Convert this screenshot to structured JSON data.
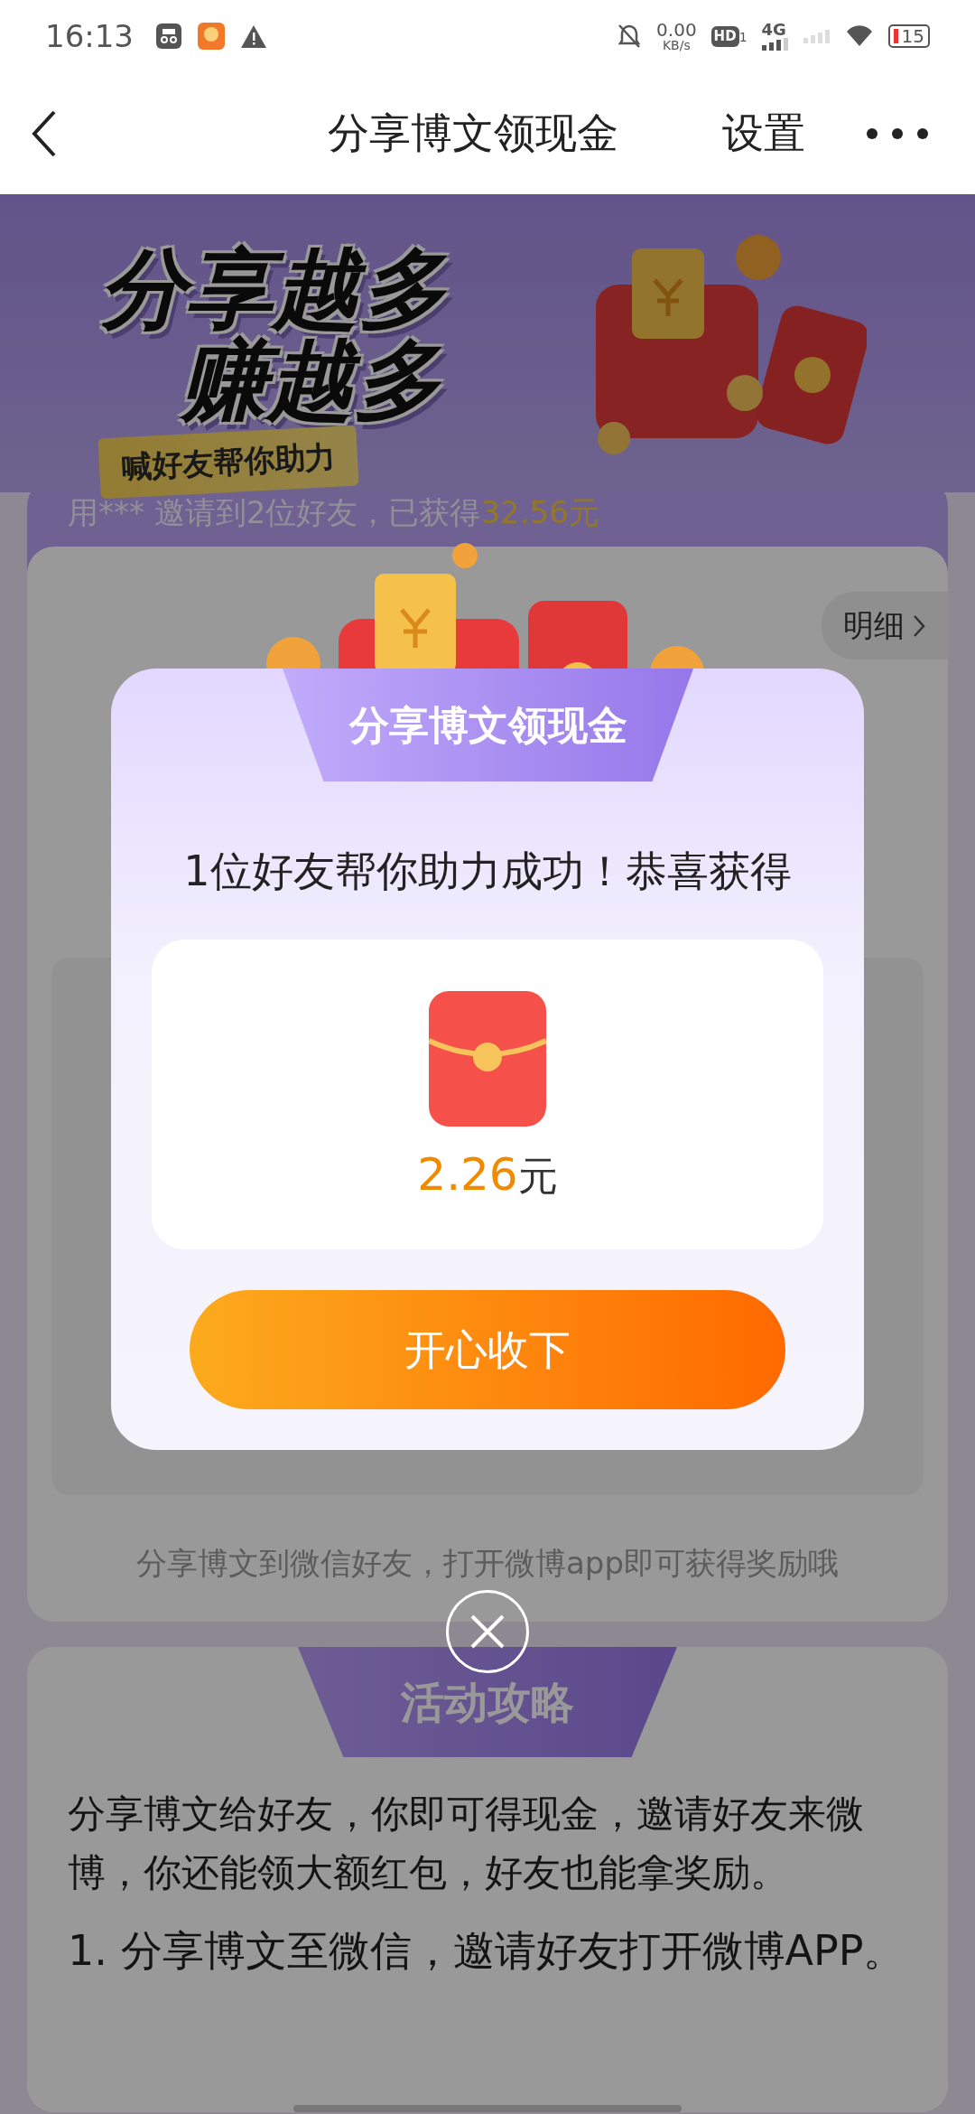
{
  "status_bar": {
    "time": "16:13",
    "net_speed": "0.00",
    "net_unit": "KB/s",
    "hd_label": "HD",
    "sim_slot": "1",
    "network": "4G",
    "battery": "15"
  },
  "nav": {
    "title": "分享博文领现金",
    "settings": "设置"
  },
  "banner": {
    "headline_1": "分享越多",
    "headline_2": "赚越多",
    "tag": "喊好友帮你助力"
  },
  "invite_strip": {
    "text": "用*** 邀请到2位好友，已获得",
    "amount": "32.56元"
  },
  "main_card": {
    "details_button": "明细",
    "hint": "分享博文到微信好友，打开微博app即可获得奖励哦"
  },
  "guide": {
    "title": "活动攻略",
    "paragraphs": [
      "分享博文给好友，你即可得现金，邀请好友来微博，你还能领大额红包，好友也能拿奖励。",
      "1. 分享博文至微信，邀请好友打开微博APP。"
    ]
  },
  "dialog": {
    "title": "分享博文领现金",
    "message": "1位好友帮你助力成功！恭喜获得",
    "amount": "2.26",
    "unit": "元",
    "button": "开心收下"
  }
}
